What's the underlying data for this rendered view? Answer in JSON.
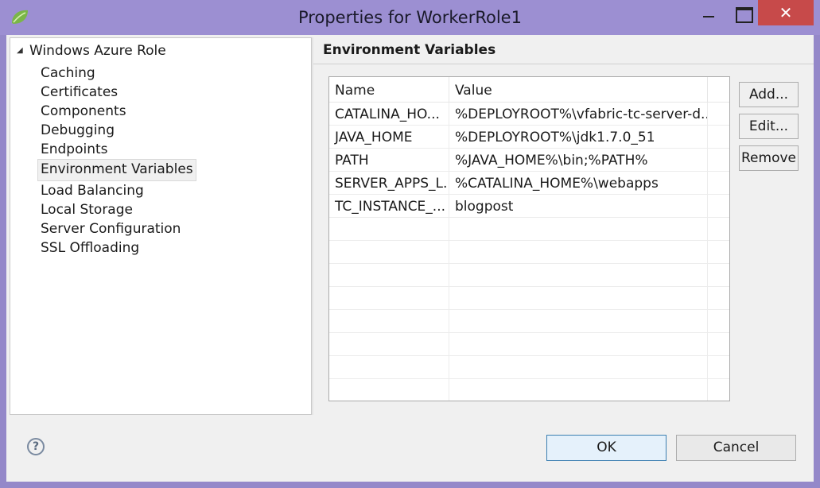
{
  "window": {
    "title": "Properties for WorkerRole1",
    "close_glyph": "✕"
  },
  "tree": {
    "root_label": "Windows Azure Role",
    "items": [
      {
        "label": "Caching"
      },
      {
        "label": "Certificates"
      },
      {
        "label": "Components"
      },
      {
        "label": "Debugging"
      },
      {
        "label": "Endpoints"
      },
      {
        "label": "Environment Variables",
        "selected": true
      },
      {
        "label": "Load Balancing"
      },
      {
        "label": "Local Storage"
      },
      {
        "label": "Server Configuration"
      },
      {
        "label": "SSL Offloading"
      }
    ]
  },
  "page": {
    "title": "Environment Variables"
  },
  "table": {
    "columns": [
      "Name",
      "Value"
    ],
    "rows": [
      {
        "name": "CATALINA_HO...",
        "value": "%DEPLOYROOT%\\vfabric-tc-server-d..."
      },
      {
        "name": "JAVA_HOME",
        "value": "%DEPLOYROOT%\\jdk1.7.0_51"
      },
      {
        "name": "PATH",
        "value": "%JAVA_HOME%\\bin;%PATH%"
      },
      {
        "name": "SERVER_APPS_L...",
        "value": "%CATALINA_HOME%\\webapps"
      },
      {
        "name": "TC_INSTANCE_...",
        "value": "blogpost"
      },
      {
        "name": "",
        "value": ""
      },
      {
        "name": "",
        "value": ""
      },
      {
        "name": "",
        "value": ""
      },
      {
        "name": "",
        "value": ""
      },
      {
        "name": "",
        "value": ""
      },
      {
        "name": "",
        "value": ""
      },
      {
        "name": "",
        "value": ""
      },
      {
        "name": "",
        "value": ""
      }
    ]
  },
  "buttons": {
    "add": "Add...",
    "edit": "Edit...",
    "remove": "Remove",
    "ok": "OK",
    "cancel": "Cancel",
    "help": "?"
  },
  "colors": {
    "titlebar": "#9c8fd2",
    "close_button": "#c74a4a",
    "ok_border": "#3c7fb1"
  }
}
